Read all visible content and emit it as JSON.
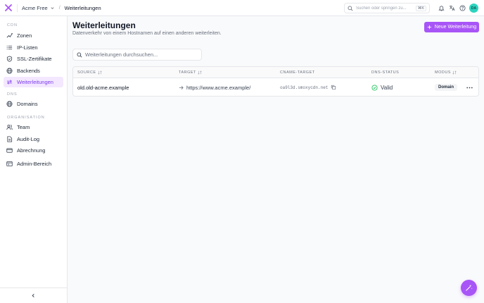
{
  "app": {
    "org_name": "Acme Free",
    "breadcrumb_current": "Weiterleitungen",
    "search_placeholder": "Suchen oder springen zu...",
    "search_shortcut": "⌘K",
    "user_initials": "DA"
  },
  "sidebar": {
    "sections": [
      {
        "label": "CDN",
        "items": [
          "Zonen",
          "IP-Listen",
          "SSL-Zertifikate",
          "Backends",
          "Weiterleitungen"
        ]
      },
      {
        "label": "DNS",
        "items": [
          "Domains"
        ]
      },
      {
        "label": "ORGANISATION",
        "items": [
          "Team",
          "Audit-Log",
          "Abrechnung"
        ]
      }
    ],
    "admin_item": "Admin-Bereich"
  },
  "page": {
    "title": "Weiterleitungen",
    "subtitle": "Datenverkehr von einem Hostnamen auf einen anderen weiterleiten.",
    "new_button": "Neue Weiterleitung",
    "filter_placeholder": "Weiterleitungen durchsuchen..."
  },
  "table": {
    "columns": [
      "Source",
      "Target",
      "CNAME-TARGET",
      "DNS-STATUS",
      "Modus"
    ],
    "rows": [
      {
        "source": "old.old-acme.example",
        "target": "https://www.acme.example/",
        "cname": "oa9l3d.smoxycdn.net",
        "dns_status": "Valid",
        "mode": "Domain"
      }
    ]
  },
  "colors": {
    "accent": "#a855f7",
    "status_valid": "#22c55e"
  }
}
